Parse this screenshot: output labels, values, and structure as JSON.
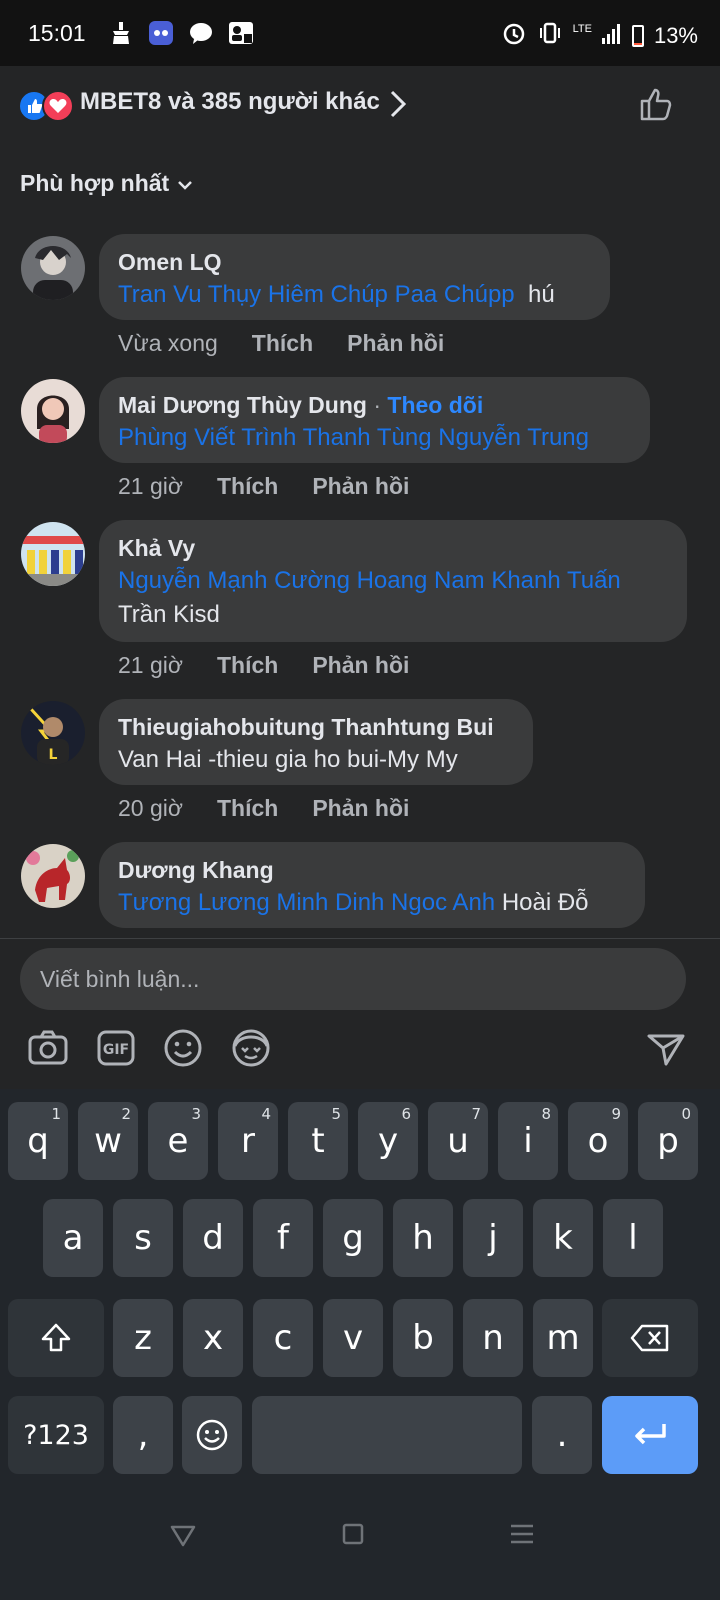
{
  "status_bar": {
    "time": "15:01",
    "network": "LTE",
    "battery_percent": "13%",
    "battery_level": 0.13
  },
  "reactions": {
    "summary": "MBET8 và 385 người khác",
    "types": [
      "like-icon",
      "love-icon"
    ]
  },
  "sort": {
    "label": "Phù hợp nhất"
  },
  "comments": [
    {
      "author": "Omen LQ",
      "follow": "",
      "tags": "Tran Vu Thụy Hiêm Chúp Paa Chúpp",
      "text": "hú",
      "time": "Vừa xong",
      "like": "Thích",
      "reply": "Phản hồi"
    },
    {
      "author": "Mai Dương Thùy Dung",
      "follow": "Theo dõi",
      "tags": "Phùng Viết Trình Thanh Tùng Nguyễn Trung",
      "text": "",
      "time": "21 giờ",
      "like": "Thích",
      "reply": "Phản hồi"
    },
    {
      "author": "Khả Vy",
      "follow": "",
      "tags": "Nguyễn Mạnh Cường Hoang Nam Khanh Tuấn",
      "text": "Trần Kisd",
      "time": "21 giờ",
      "like": "Thích",
      "reply": "Phản hồi"
    },
    {
      "author": "Thieugiahobuitung Thanhtung Bui",
      "follow": "",
      "tags": "",
      "text": "Van Hai -thieu gia ho bui-My My",
      "time": "20 giờ",
      "like": "Thích",
      "reply": "Phản hồi"
    },
    {
      "author": "Dương Khang",
      "follow": "",
      "tags": "Tương Lương Minh Dinh Ngoc Anh",
      "text": "Hoài Đỗ",
      "time": "",
      "like": "",
      "reply": ""
    }
  ],
  "composer": {
    "placeholder": "Viết bình luận...",
    "gif_label": "GIF",
    "tools": [
      "camera-icon",
      "gif-icon",
      "emoji-icon",
      "avatar-sticker-icon",
      "send-icon"
    ]
  },
  "keyboard": {
    "row1": [
      [
        "q",
        "1"
      ],
      [
        "w",
        "2"
      ],
      [
        "e",
        "3"
      ],
      [
        "r",
        "4"
      ],
      [
        "t",
        "5"
      ],
      [
        "y",
        "6"
      ],
      [
        "u",
        "7"
      ],
      [
        "i",
        "8"
      ],
      [
        "o",
        "9"
      ],
      [
        "p",
        "0"
      ]
    ],
    "row2": [
      "a",
      "s",
      "d",
      "f",
      "g",
      "h",
      "j",
      "k",
      "l"
    ],
    "row3": [
      "z",
      "x",
      "c",
      "v",
      "b",
      "n",
      "m"
    ],
    "symbols": "?123",
    "comma": ",",
    "period": "."
  }
}
